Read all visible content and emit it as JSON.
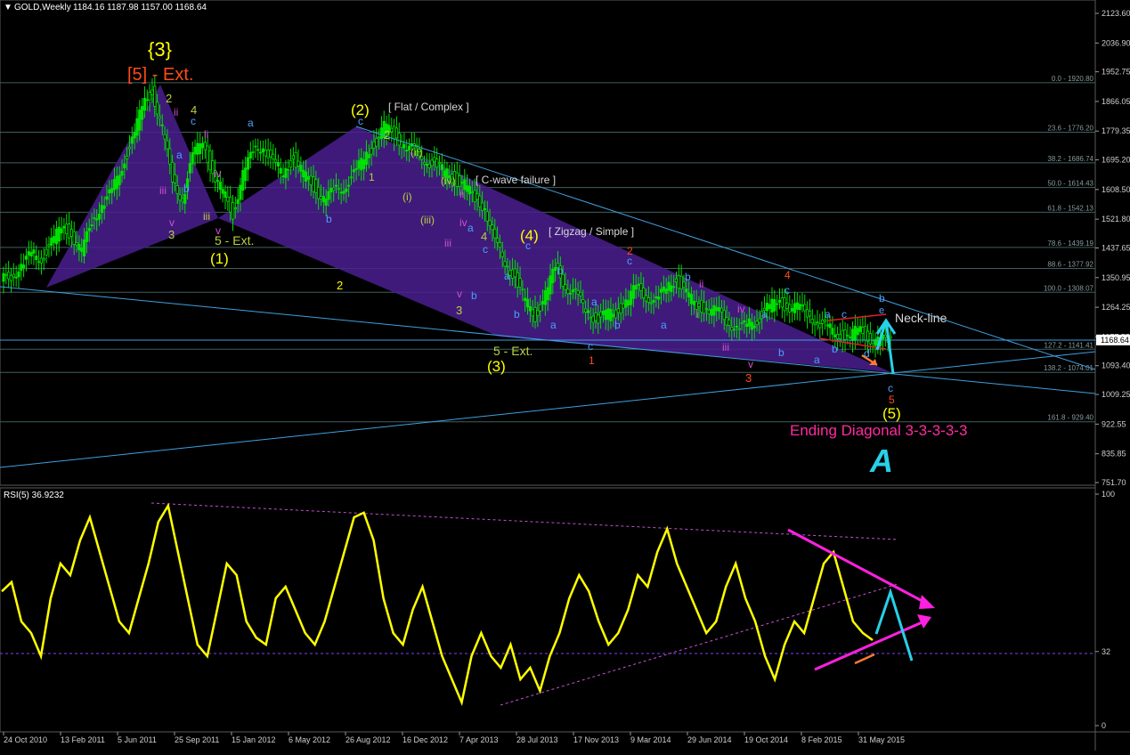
{
  "header": {
    "symbol": "GOLD,Weekly",
    "ohlc": "1184.16 1187.98 1157.00 1168.64"
  },
  "rsi_header": "RSI(5) 36.9232",
  "colors": {
    "background": "#000000",
    "grid": "#2e4a4a",
    "candle": "#00e000",
    "fib_line": "#4a6a6a",
    "trendline": "#3ea0e0",
    "wedge_fill": "#4a1f8f",
    "rsi_line": "#ffff00",
    "label_yellow": "#ffff00",
    "label_orange": "#ff4a1a",
    "label_green": "#b8d040",
    "label_blue": "#4aa0ff",
    "label_magenta": "#d050d0",
    "label_pink": "#ff2aa0",
    "neckline_red": "#e02020",
    "cyan": "#28d0e8",
    "arrow_orange": "#ff7a30"
  },
  "chart_data": [
    {
      "type": "line",
      "title": "GOLD,Weekly",
      "y_ticks": [
        "2123.60",
        "2036.90",
        "1952.75",
        "1866.05",
        "1779.35",
        "1695.20",
        "1608.50",
        "1521.80",
        "1437.65",
        "1350.95",
        "1264.25",
        "1177.55",
        "1093.40",
        "1009.25",
        "922.55",
        "835.85",
        "751.70"
      ],
      "current_price": "1168.64",
      "x_ticks": [
        "24 Oct 2010",
        "13 Feb 2011",
        "5 Jun 2011",
        "25 Sep 2011",
        "15 Jan 2012",
        "6 May 2012",
        "26 Aug 2012",
        "16 Dec 2012",
        "7 Apr 2013",
        "28 Jul 2013",
        "17 Nov 2013",
        "9 Mar 2014",
        "29 Jun 2014",
        "19 Oct 2014",
        "8 Feb 2015",
        "31 May 2015"
      ],
      "fib_levels": [
        {
          "label": "0.0 - 1920.80",
          "y": 1920.8
        },
        {
          "label": "23.6 - 1776.20",
          "y": 1776.2
        },
        {
          "label": "38.2 - 1686.74",
          "y": 1686.74
        },
        {
          "label": "50.0 - 1614.43",
          "y": 1614.43
        },
        {
          "label": "61.8 - 1542.13",
          "y": 1542.13
        },
        {
          "label": "78.6 - 1439.19",
          "y": 1439.19
        },
        {
          "label": "88.6 - 1377.92",
          "y": 1377.92
        },
        {
          "label": "100.0 - 1308.07",
          "y": 1308.07
        },
        {
          "label": "127.2 - 1141.41",
          "y": 1141.41
        },
        {
          "label": "138.2 - 1074.01",
          "y": 1074.01
        },
        {
          "label": "161.8 - 929.40",
          "y": 929.4
        }
      ],
      "series": [
        {
          "values": [
            1340,
            1360,
            1380,
            1420,
            1410,
            1450,
            1500,
            1480,
            1420,
            1520,
            1560,
            1600,
            1680,
            1750,
            1850,
            1900,
            1780,
            1640,
            1580,
            1700,
            1760,
            1650,
            1600,
            1540,
            1650,
            1720,
            1740,
            1680,
            1660,
            1700,
            1650,
            1620,
            1580,
            1600,
            1620,
            1650,
            1700,
            1740,
            1790,
            1770,
            1740,
            1720,
            1700,
            1680,
            1660,
            1640,
            1620,
            1580,
            1560,
            1450,
            1400,
            1350,
            1280,
            1240,
            1300,
            1380,
            1330,
            1300,
            1260,
            1230,
            1240,
            1250,
            1280,
            1320,
            1300,
            1280,
            1320,
            1350,
            1300,
            1270,
            1260,
            1250,
            1230,
            1200,
            1210,
            1230,
            1260,
            1280,
            1270,
            1260,
            1250,
            1220,
            1200,
            1190,
            1170,
            1200,
            1180,
            1160,
            1170
          ]
        }
      ]
    },
    {
      "type": "line",
      "title": "RSI(5) 36.9232",
      "y_ticks": [
        "100",
        "32",
        "0"
      ],
      "series": [
        {
          "values": [
            58,
            62,
            45,
            40,
            30,
            55,
            70,
            65,
            80,
            90,
            75,
            60,
            45,
            40,
            55,
            70,
            88,
            95,
            75,
            55,
            35,
            30,
            50,
            70,
            65,
            45,
            38,
            35,
            55,
            60,
            50,
            40,
            35,
            45,
            60,
            75,
            90,
            92,
            80,
            55,
            40,
            35,
            50,
            60,
            45,
            30,
            20,
            10,
            30,
            40,
            30,
            25,
            35,
            20,
            25,
            15,
            30,
            40,
            55,
            65,
            58,
            45,
            35,
            40,
            50,
            65,
            60,
            75,
            85,
            70,
            60,
            50,
            40,
            45,
            60,
            70,
            55,
            45,
            30,
            20,
            35,
            45,
            40,
            55,
            70,
            75,
            60,
            45,
            40,
            36.92
          ]
        }
      ]
    }
  ],
  "wave_labels": {
    "l_3_big": "{3}",
    "l_5_ext": "[5] - Ext.",
    "l_2p": "(2)",
    "l_flat": "[ Flat / Complex ]",
    "l_cwave": "[ C-wave failure ]",
    "l_4p": "(4)",
    "l_zigzag": "[ Zigzag / Simple ]",
    "l_1p": "(1)",
    "l_5ext_1": "5 - Ext.",
    "l_3p": "(3)",
    "l_5ext_3": "5 - Ext.",
    "l_5p": "(5)",
    "l_neck": "Neck-line",
    "l_ending": "Ending Diagonal 3-3-3-3-3",
    "l_logo": "A",
    "s_2a": "2",
    "s_4a": "4",
    "s_ii_a": "ii",
    "s_iii_a": "iii",
    "s_iv_a": "iv",
    "s_v_a": "v",
    "s_3a": "3",
    "s_ii_b": "ii",
    "s_iii_b": "iii",
    "s_v_b": "v",
    "s_c_a": "c",
    "s_a_a": "a",
    "s_b_a": "b",
    "s_a_b": "a",
    "s_b_b": "b",
    "s_c_b": "c",
    "s_2b": "2",
    "s_1a": "1",
    "s_ii_p": "(ii)",
    "s_i_p": "(i)",
    "s_iii_p": "(iii)",
    "s_iv_p": "(iv)",
    "s_i_c": "i",
    "s_ii_c": "ii",
    "s_iv_c": "iv",
    "s_iii_c": "iii",
    "s_v_c": "v",
    "s_a_c": "a",
    "s_b_c": "b",
    "s_c_c": "c",
    "s_4b": "4",
    "s_3b": "3",
    "s_a_d": "a",
    "s_b_d": "b",
    "s_c_d": "c",
    "s_b_e": "b",
    "s_a_e": "a",
    "s_c_e": "c",
    "s_1b": "1",
    "s_2c": "2",
    "s_a_f": "a",
    "s_b_f": "b",
    "s_b_g": "b",
    "s_a_g": "a",
    "s_c_g": "c",
    "s_i_d": "i",
    "s_ii_d": "ii",
    "s_iii_d": "iii",
    "s_iv_d": "iv",
    "s_v_d": "v",
    "s_3c": "3",
    "s_4c": "4",
    "s_c_h": "c",
    "s_a_h": "a",
    "s_b_h": "b",
    "s_a_i": "a",
    "s_c_i": "c",
    "s_d_i": "d",
    "s_e_i": "e",
    "s_b_i": "b",
    "s_c_j": "c",
    "s_5a": "5",
    "s_2mid": "2"
  }
}
